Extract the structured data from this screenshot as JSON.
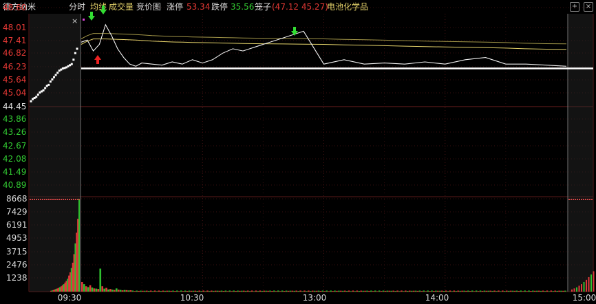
{
  "header": {
    "stock_name": "德方纳米",
    "tab_fenshi": "分时",
    "tab_junxian": "均线",
    "tab_volume": "成交量",
    "tab_auction": "竞价图",
    "limit_up_label": "涨停",
    "limit_up_value": "53.34",
    "limit_down_label": "跌停",
    "limit_down_value": "35.56",
    "cage_label": "笼子",
    "cage_value": "(47.12 45.27)",
    "sector": "电池化学品",
    "add_icon": "plus-icon",
    "close_icon": "close-icon"
  },
  "price_axis": {
    "labels": [
      "48.60",
      "48.01",
      "47.41",
      "46.82",
      "46.23",
      "45.64",
      "45.04",
      "44.45",
      "43.86",
      "43.26",
      "42.67",
      "42.08",
      "41.49",
      "40.89"
    ],
    "colors": [
      "#e53935",
      "#e53935",
      "#e53935",
      "#e53935",
      "#e53935",
      "#e53935",
      "#e53935",
      "#dddddd",
      "#33cc33",
      "#33cc33",
      "#33cc33",
      "#33cc33",
      "#33cc33",
      "#33cc33"
    ]
  },
  "volume_axis": {
    "labels": [
      "8668",
      "7429",
      "6191",
      "4953",
      "3715",
      "2476",
      "1238"
    ]
  },
  "time_axis": {
    "labels": [
      "09:30",
      "10:30",
      "13:00",
      "14:00",
      "15:00"
    ]
  },
  "chart_data": {
    "type": "line",
    "prev_close": 44.45,
    "ylim": [
      40.3,
      48.6
    ],
    "pre_market_price": [
      44.6,
      44.7,
      44.75,
      44.8,
      44.9,
      45.0,
      45.05,
      45.1,
      45.2,
      45.3,
      45.35,
      45.5,
      45.6,
      45.7,
      45.8,
      45.9,
      46.0,
      46.05,
      46.1,
      46.12,
      46.15,
      46.2,
      46.25,
      46.3,
      46.5,
      46.8,
      47.0
    ],
    "price_x_minutes": [
      0,
      3,
      6,
      9,
      12,
      15,
      18,
      21,
      24,
      27,
      30,
      35,
      40,
      45,
      50,
      55,
      60,
      65,
      70,
      75,
      80,
      90,
      100,
      110,
      120,
      130,
      140,
      150,
      160,
      170,
      180,
      190,
      200,
      210,
      220,
      230,
      240
    ],
    "price": [
      47.3,
      47.4,
      46.9,
      47.2,
      48.1,
      47.6,
      47.0,
      46.6,
      46.3,
      46.2,
      46.35,
      46.3,
      46.25,
      46.4,
      46.3,
      46.5,
      46.35,
      46.5,
      46.8,
      47.0,
      46.9,
      47.2,
      47.5,
      47.8,
      46.3,
      46.5,
      46.3,
      46.35,
      46.3,
      46.4,
      46.3,
      46.5,
      46.6,
      46.3,
      46.3,
      46.25,
      46.2
    ],
    "avg_price": [
      47.2,
      47.35,
      47.45,
      47.45,
      47.45,
      47.44,
      47.43,
      47.42,
      47.41,
      47.4,
      47.38,
      47.35,
      47.33,
      47.31,
      47.3,
      47.29,
      47.28,
      47.27,
      47.26,
      47.25,
      47.24,
      47.23,
      47.22,
      47.21,
      47.2,
      47.18,
      47.16,
      47.14,
      47.12,
      47.1,
      47.08,
      47.07,
      47.05,
      47.03,
      47.0,
      46.98,
      46.97
    ],
    "support_line": 46.1,
    "limit_up": 53.34,
    "limit_down": 35.56,
    "volume_ylim": [
      0,
      8668
    ],
    "pre_market_volume": [
      80,
      120,
      150,
      200,
      260,
      300,
      350,
      420,
      500,
      600,
      700,
      850,
      1000,
      1200,
      1500,
      1800,
      2200,
      2700,
      3500,
      4500,
      5500,
      6800,
      8668
    ],
    "volume_head": [
      900,
      700,
      500,
      420,
      600,
      380,
      300,
      280,
      250,
      2150,
      500,
      280,
      350,
      200,
      250,
      180,
      150,
      300,
      180,
      160,
      120,
      150,
      140,
      110,
      130,
      100
    ],
    "volume_tail_level": 70,
    "close_volume": [
      200,
      300,
      400,
      550,
      700,
      900,
      1100,
      1350,
      1600,
      1900
    ]
  }
}
